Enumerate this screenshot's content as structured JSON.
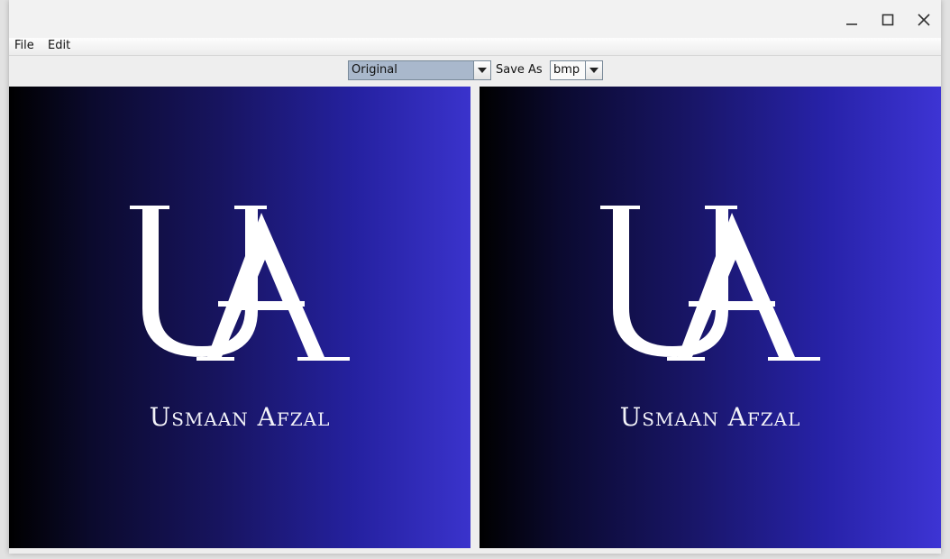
{
  "window": {
    "controls": {
      "minimize": "minimize-icon",
      "maximize": "maximize-icon",
      "close": "close-icon"
    }
  },
  "menubar": {
    "items": [
      {
        "label": "File"
      },
      {
        "label": "Edit"
      }
    ]
  },
  "toolbar": {
    "filter_select": {
      "value": "Original"
    },
    "save_as_label": "Save As",
    "format_select": {
      "value": "bmp"
    }
  },
  "panels": {
    "left": {
      "logo_letters": "UA",
      "caption": "Usmaan Afzal"
    },
    "right": {
      "logo_letters": "UA",
      "caption": "Usmaan Afzal"
    }
  },
  "colors": {
    "gradient_start": "#000000",
    "gradient_end": "#3a33cc",
    "combo_selected_bg": "#a9b8cc",
    "logo_text": "#ffffff"
  }
}
